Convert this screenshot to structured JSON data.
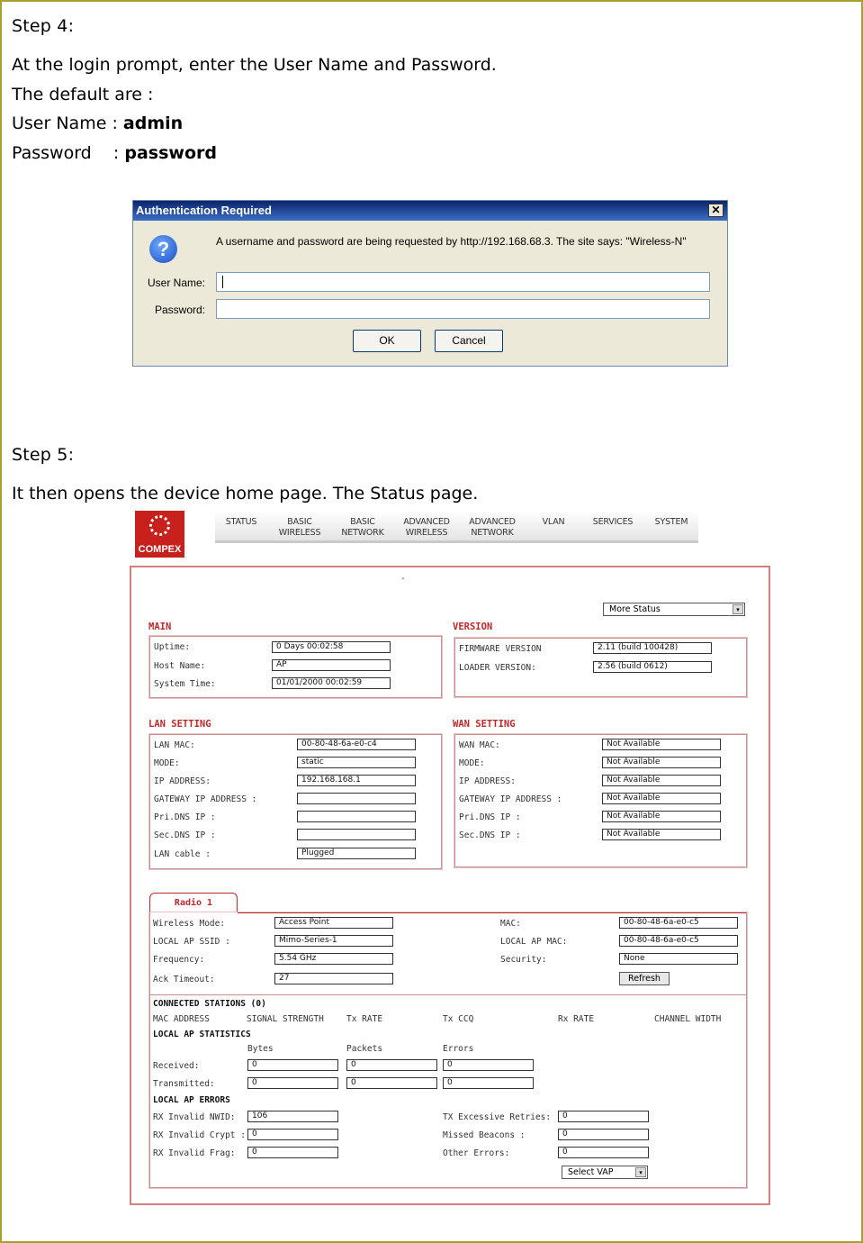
{
  "step4": {
    "heading": "Step 4:",
    "line1": "At the login prompt, enter the User Name and Password.",
    "line2": "The default are :",
    "user_label": "User Name : ",
    "user_value": "admin",
    "pass_label": "Password    : ",
    "pass_value": "password"
  },
  "dialog": {
    "title": "Authentication Required",
    "close": "✕",
    "icon": "question-icon",
    "message": "A username and password are being requested by http://192.168.68.3. The site says: \"Wireless-N\"",
    "user_label": "User Name:",
    "pass_label": "Password:",
    "ok": "OK",
    "cancel": "Cancel"
  },
  "step5": {
    "heading": "Step 5:",
    "line1": "It then opens the device home page. The Status page."
  },
  "compex": {
    "logo": "COMPEX",
    "nav": [
      {
        "l1": "STATUS",
        "l2": ""
      },
      {
        "l1": "BASIC",
        "l2": "WIRELESS"
      },
      {
        "l1": "BASIC",
        "l2": "NETWORK"
      },
      {
        "l1": "ADVANCED",
        "l2": "WIRELESS"
      },
      {
        "l1": "ADVANCED",
        "l2": "NETWORK"
      },
      {
        "l1": "VLAN",
        "l2": ""
      },
      {
        "l1": "SERVICES",
        "l2": ""
      },
      {
        "l1": "SYSTEM",
        "l2": ""
      }
    ],
    "more_status": "More Status",
    "dash": "-",
    "main": {
      "title": "MAIN",
      "uptime_label": "Uptime:",
      "uptime": "0 Days 00:02:58",
      "host_label": "Host Name:",
      "host": "AP",
      "time_label": "System Time:",
      "time": "01/01/2000 00:02:59"
    },
    "version": {
      "title": "VERSION",
      "fw_label": "FIRMWARE VERSION",
      "fw": "2.11 (build 100428)",
      "loader_label": "LOADER VERSION:",
      "loader": "2.56 (build 0612)"
    },
    "lan": {
      "title": "LAN SETTING",
      "rows": [
        {
          "label": "LAN MAC:",
          "value": "00-80-48-6a-e0-c4"
        },
        {
          "label": "MODE:",
          "value": "static"
        },
        {
          "label": "IP ADDRESS:",
          "value": "192.168.168.1"
        },
        {
          "label": "GATEWAY IP ADDRESS :",
          "value": ""
        },
        {
          "label": "Pri.DNS IP :",
          "value": ""
        },
        {
          "label": "Sec.DNS IP :",
          "value": ""
        },
        {
          "label": "LAN cable :",
          "value": "Plugged"
        }
      ]
    },
    "wan": {
      "title": "WAN SETTING",
      "rows": [
        {
          "label": "WAN MAC:",
          "value": "Not Available"
        },
        {
          "label": "MODE:",
          "value": "Not Available"
        },
        {
          "label": "IP ADDRESS:",
          "value": "Not Available"
        },
        {
          "label": "GATEWAY IP ADDRESS :",
          "value": "Not Available"
        },
        {
          "label": "Pri.DNS IP :",
          "value": "Not Available"
        },
        {
          "label": "Sec.DNS IP :",
          "value": "Not Available"
        }
      ]
    },
    "radio": {
      "tab": "Radio 1",
      "wm_label": "Wireless Mode:",
      "wm": "Access Point",
      "ssid_label": "LOCAL AP SSID :",
      "ssid": "Mimo-Series-1",
      "freq_label": "Frequency:",
      "freq": "5.54 GHz",
      "ack_label": "Ack Timeout:",
      "ack": "27",
      "mac_label": "MAC:",
      "mac": "00-80-48-6a-e0-c5",
      "lmac_label": "LOCAL AP MAC:",
      "lmac": "00-80-48-6a-e0-c5",
      "sec_label": "Security:",
      "sec": "None",
      "refresh": "Refresh"
    },
    "stations": {
      "title": "CONNECTED STATIONS  (0)",
      "cols": [
        "MAC ADDRESS",
        "SIGNAL STRENGTH",
        "Tx RATE",
        "Tx CCQ",
        "Rx RATE",
        "CHANNEL WIDTH"
      ]
    },
    "stats": {
      "title": "LOCAL AP STATISTICS",
      "bytes": "Bytes",
      "packets": "Packets",
      "errors": "Errors",
      "recv_label": "Received:",
      "recv": [
        "0",
        "0",
        "0"
      ],
      "trans_label": "Transmitted:",
      "trans": [
        "0",
        "0",
        "0"
      ]
    },
    "errors": {
      "title": "LOCAL AP ERRORS",
      "nwid_label": "RX Invalid NWID:",
      "nwid": "106",
      "crypt_label": "RX Invalid Crypt :",
      "crypt": "0",
      "frag_label": "RX Invalid Frag:",
      "frag": "0",
      "retries_label": "TX Excessive Retries:",
      "retries": "0",
      "beacons_label": "Missed Beacons :",
      "beacons": "0",
      "other_label": "Other Errors:",
      "other": "0",
      "select_vap": "Select VAP"
    }
  }
}
